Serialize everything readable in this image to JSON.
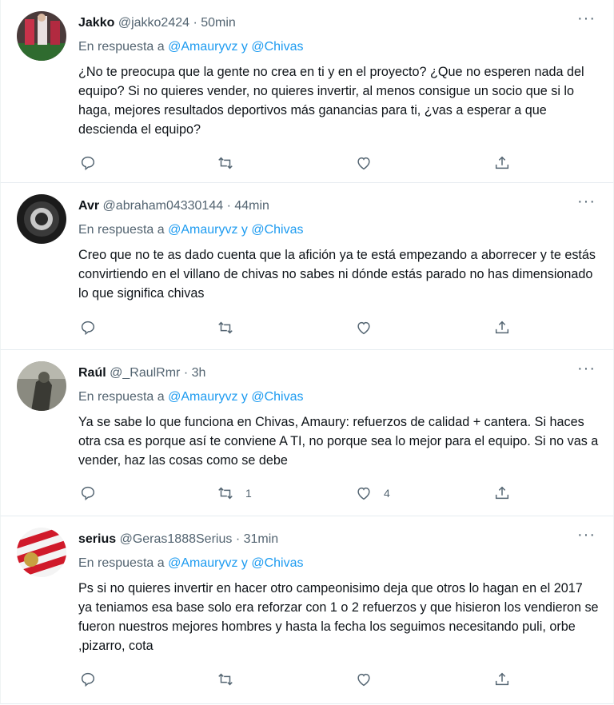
{
  "tweets": [
    {
      "name": "Jakko",
      "handle": "@jakko2424",
      "separator": "·",
      "time": "50min",
      "reply_prefix": "En respuesta a",
      "reply_user1": "@Amauryvz",
      "reply_and": "y",
      "reply_user2": "@Chivas",
      "text": "¿No te preocupa que la gente no crea en ti y en el proyecto? ¿Que no esperen nada del equipo? Si no quieres vender, no quieres invertir, al menos consigue un socio que si lo haga, mejores resultados deportivos más ganancias para ti, ¿vas a esperar a que descienda el equipo?",
      "retweets": "",
      "likes": "",
      "more": "···"
    },
    {
      "name": "Avr",
      "handle": "@abraham04330144",
      "separator": "·",
      "time": "44min",
      "reply_prefix": "En respuesta a",
      "reply_user1": "@Amauryvz",
      "reply_and": "y",
      "reply_user2": "@Chivas",
      "text": "Creo que no te as dado cuenta que la afición ya te está empezando a aborrecer y te estás convirtiendo en el villano de chivas no sabes ni dónde estás parado no has dimensionado lo que significa chivas",
      "retweets": "",
      "likes": "",
      "more": "···"
    },
    {
      "name": "Raúl",
      "handle": "@_RaulRmr",
      "separator": "·",
      "time": "3h",
      "reply_prefix": "En respuesta a",
      "reply_user1": "@Amauryvz",
      "reply_and": "y",
      "reply_user2": "@Chivas",
      "text": "Ya se sabe lo que funciona en Chivas, Amaury: refuerzos de calidad + cantera. Si haces otra csa es porque así te conviene A TI, no porque sea lo mejor para el equipo. Si no vas a vender, haz las cosas como se debe",
      "retweets": "1",
      "likes": "4",
      "more": "···"
    },
    {
      "name": "serius",
      "handle": "@Geras1888Serius",
      "separator": "·",
      "time": "31min",
      "reply_prefix": "En respuesta a",
      "reply_user1": "@Amauryvz",
      "reply_and": "y",
      "reply_user2": "@Chivas",
      "text": "Ps si no quieres invertir en hacer otro campeonisimo deja que otros lo hagan en el 2017 ya teniamos esa base solo era reforzar con 1 o 2 refuerzos y que hisieron los vendieron se fueron nuestros mejores hombres y hasta la fecha los seguimos necesitando puli, orbe ,pizarro, cota",
      "retweets": "",
      "likes": "",
      "more": "···"
    }
  ],
  "colors": {
    "link": "#1d9bf0",
    "secondary": "#536471",
    "text": "#0f1419",
    "border": "#e6ecf0"
  },
  "icons": [
    "reply-icon",
    "retweet-icon",
    "like-icon",
    "share-icon",
    "more-icon"
  ]
}
